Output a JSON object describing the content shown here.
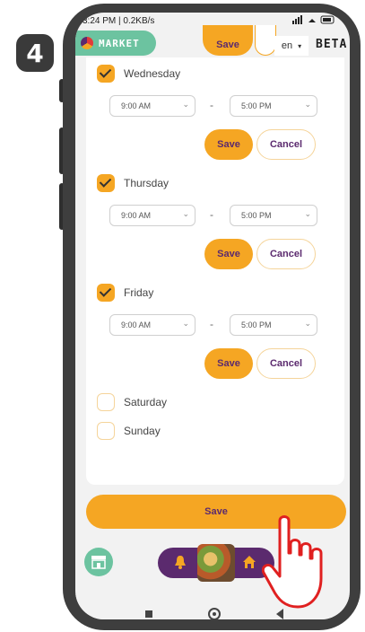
{
  "step": {
    "number": "4"
  },
  "status_bar": {
    "time_info": "3:24 PM | 0.2KB/s",
    "icons": "signal-wifi-battery"
  },
  "header": {
    "market_label": "MARKET",
    "save_label": "Save",
    "language": "en",
    "beta_label": "BETA"
  },
  "days": [
    {
      "name": "Wednesday",
      "checked": true,
      "start": "9:00 AM",
      "end": "5:00 PM",
      "save_label": "Save",
      "cancel_label": "Cancel"
    },
    {
      "name": "Thursday",
      "checked": true,
      "start": "9:00 AM",
      "end": "5:00 PM",
      "save_label": "Save",
      "cancel_label": "Cancel"
    },
    {
      "name": "Friday",
      "checked": true,
      "start": "9:00 AM",
      "end": "5:00 PM",
      "save_label": "Save",
      "cancel_label": "Cancel"
    },
    {
      "name": "Saturday",
      "checked": false
    },
    {
      "name": "Sunday",
      "checked": false
    }
  ],
  "time_separator": "-",
  "footer": {
    "save_label": "Save"
  },
  "colors": {
    "accent": "#f5a623",
    "brand_purple": "#5b2a6e",
    "market_green": "#6cc3a0"
  }
}
